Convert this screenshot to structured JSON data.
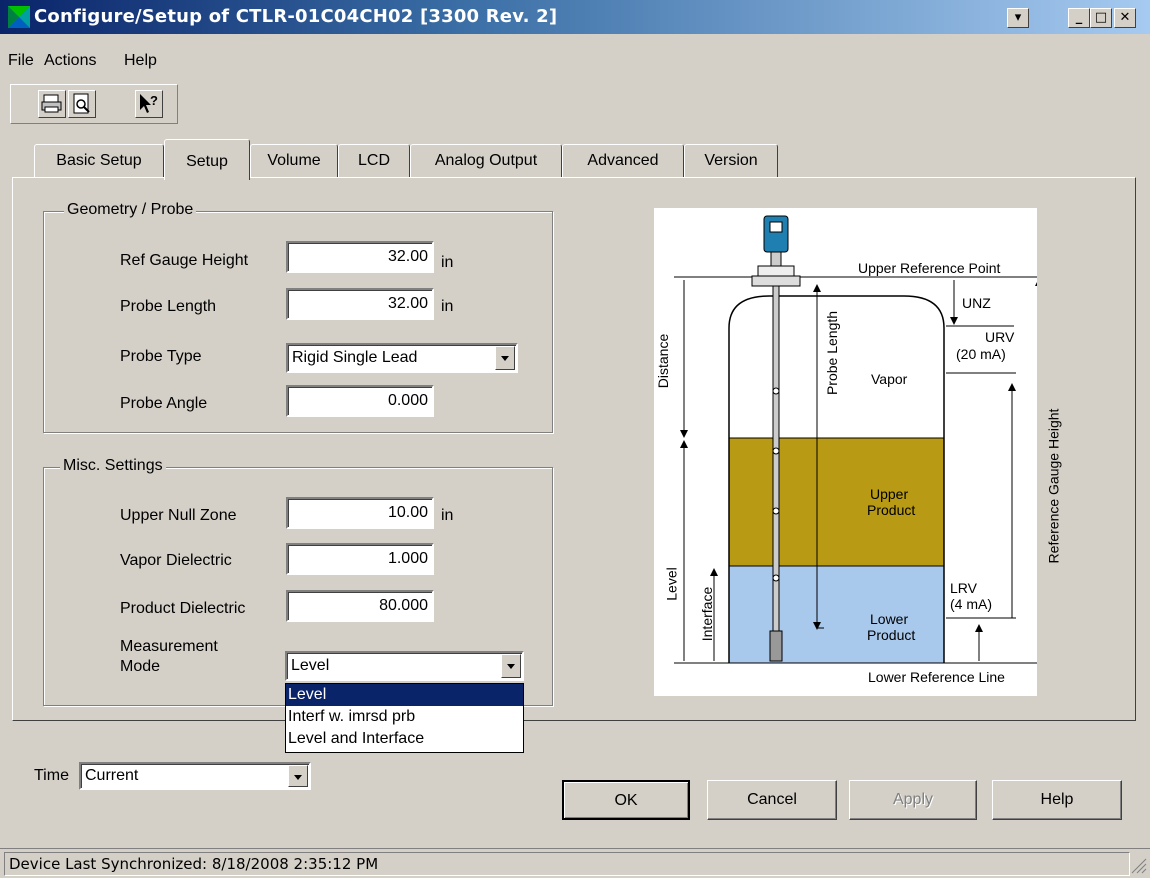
{
  "window": {
    "title": "Configure/Setup of CTLR-01C04CH02 [3300 Rev. 2]",
    "controls": [
      "▾",
      "_",
      "□",
      "✕"
    ]
  },
  "menu": [
    "File",
    "Actions",
    "Help"
  ],
  "toolbar": {
    "icons": [
      "printer-icon",
      "print-preview-icon",
      "context-help-icon"
    ]
  },
  "tabs": [
    "Basic Setup",
    "Setup",
    "Volume",
    "LCD",
    "Analog Output",
    "Advanced",
    "Version"
  ],
  "active_tab": "Setup",
  "geometry": {
    "title": "Geometry / Probe",
    "ref_gauge_height": {
      "label": "Ref Gauge Height",
      "value": "32.00",
      "unit": "in"
    },
    "probe_length": {
      "label": "Probe Length",
      "value": "32.00",
      "unit": "in"
    },
    "probe_type": {
      "label": "Probe Type",
      "value": "Rigid Single Lead"
    },
    "probe_angle": {
      "label": "Probe Angle",
      "value": "0.000"
    }
  },
  "misc": {
    "title": "Misc. Settings",
    "upper_null_zone": {
      "label": "Upper Null Zone",
      "value": "10.00",
      "unit": "in"
    },
    "vapor_dielectric": {
      "label": "Vapor Dielectric",
      "value": "1.000"
    },
    "product_dielectric": {
      "label": "Product Dielectric",
      "value": "80.000"
    },
    "measurement_mode": {
      "label_line1": "Measurement",
      "label_line2": "Mode",
      "value": "Level",
      "options": [
        "Level",
        "Interf w. imrsd prb",
        "Level and Interface"
      ]
    }
  },
  "diagram": {
    "upper_reference_point": "Upper Reference Point",
    "unz": "UNZ",
    "urv": "URV",
    "urv_ma": "(20 mA)",
    "distance": "Distance",
    "probe_length": "Probe Length",
    "vapor": "Vapor",
    "reference_gauge_height": "Reference Gauge Height",
    "upper_product_1": "Upper",
    "upper_product_2": "Product",
    "level": "Level",
    "interface": "Interface",
    "lrv": "LRV",
    "lrv_ma": "(4 mA)",
    "lower_product_1": "Lower",
    "lower_product_2": "Product",
    "lower_reference_line": "Lower Reference Line",
    "colors": {
      "vapor": "#ffffff",
      "upper_product": "#b89a14",
      "lower_product": "#a8c8ec",
      "transmitter": "#1e7fb0"
    }
  },
  "time": {
    "label": "Time",
    "value": "Current"
  },
  "buttons": {
    "ok": "OK",
    "cancel": "Cancel",
    "apply": "Apply",
    "help": "Help"
  },
  "status": "Device Last Synchronized: 8/18/2008 2:35:12 PM"
}
